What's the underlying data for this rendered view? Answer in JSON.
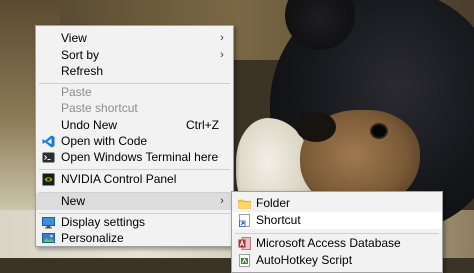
{
  "menu": {
    "items": {
      "view": "View",
      "sort_by": "Sort by",
      "refresh": "Refresh",
      "paste": "Paste",
      "paste_shortcut": "Paste shortcut",
      "undo_new": "Undo New",
      "undo_new_shortcut": "Ctrl+Z",
      "open_with_code": "Open with Code",
      "open_terminal": "Open Windows Terminal here",
      "nvidia": "NVIDIA Control Panel",
      "new": "New",
      "display_settings": "Display settings",
      "personalize": "Personalize"
    },
    "submenu_arrow": "›"
  },
  "submenu": {
    "items": {
      "folder": "Folder",
      "shortcut": "Shortcut",
      "access": "Microsoft Access Database",
      "autohotkey": "AutoHotkey Script"
    }
  },
  "colors": {
    "menu_bg": "#f2f2f2",
    "hover_bg": "#dcdcdc",
    "disabled_text": "#8d8d8d",
    "vscode_blue": "#1a7bd0",
    "nvidia_green": "#76b900",
    "access_red": "#a4373a",
    "folder_yellow": "#f5c542"
  },
  "icons": {
    "vscode": "vscode-icon",
    "terminal": "terminal-icon",
    "nvidia": "nvidia-icon",
    "display": "display-icon",
    "personalize": "personalize-icon",
    "folder": "folder-icon",
    "shortcut": "shortcut-icon",
    "access": "access-icon",
    "autohotkey": "autohotkey-icon"
  }
}
